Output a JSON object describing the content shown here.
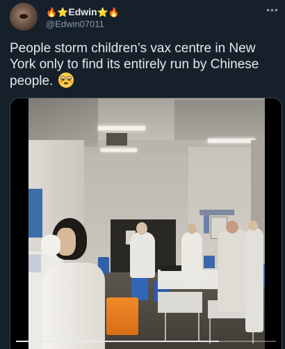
{
  "author": {
    "display_name": "Edwin",
    "emoji_prefix": "🔥⭐",
    "emoji_suffix": "⭐🔥",
    "handle": "@Edwin07011",
    "avatar_icon": "profile-avatar"
  },
  "more_icon": "more-horizontal-icon",
  "tweet": {
    "text": "People storm children’s vax centre in New York only to find its entirely run by Chinese people.",
    "emoji": "flushed-face-emoji"
  },
  "media": {
    "type": "video",
    "progress": 0.78,
    "content_icon": "video-thumbnail"
  },
  "colors": {
    "background": "#15202b",
    "text": "#e7e9ea",
    "secondary": "#8b98a5",
    "border": "#38444d"
  }
}
